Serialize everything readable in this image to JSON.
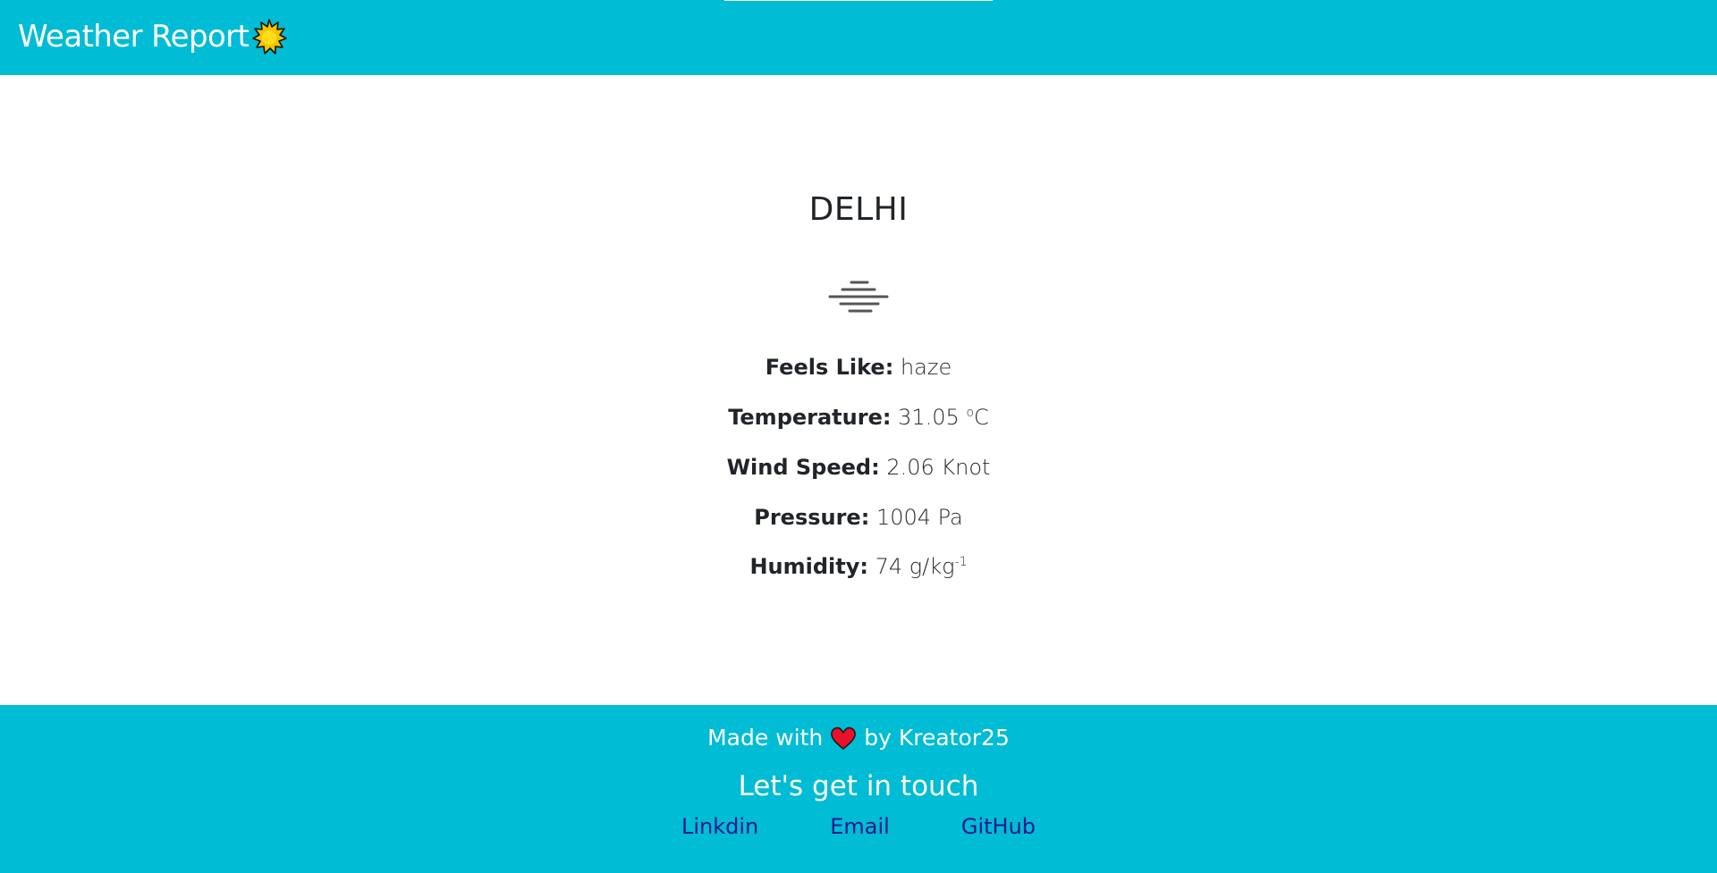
{
  "header": {
    "brand": "Weather Report",
    "brand_icon": "sun-icon",
    "color": "#00bcd4"
  },
  "main": {
    "city": "DELHI",
    "condition_icon": "haze-icon",
    "details": [
      {
        "label": "Feels Like:",
        "value": "haze"
      },
      {
        "label": "Temperature:",
        "value": "31.05 ",
        "sup": "o",
        "suffix": "C"
      },
      {
        "label": "Wind Speed:",
        "value": "2.06 Knot"
      },
      {
        "label": "Pressure:",
        "value": "1004 Pa"
      },
      {
        "label": "Humidity:",
        "value": "74 g/kg",
        "sup": "-1"
      }
    ]
  },
  "footer": {
    "made_prefix": "Made with",
    "made_suffix": "by Kreator25",
    "heart_icon": "heart-icon",
    "touch": "Let's get in touch",
    "links": [
      "Linkdin",
      "Email",
      "GitHub"
    ],
    "link_color": "#1a1a8c"
  }
}
